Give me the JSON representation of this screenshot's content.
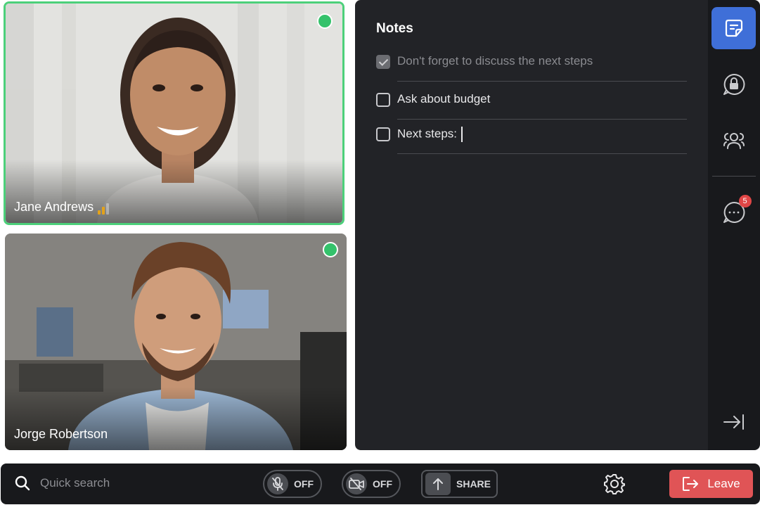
{
  "participants": [
    {
      "name": "Jane Andrews",
      "status_color": "#34c26b",
      "signal_level": 2,
      "active_speaker": true
    },
    {
      "name": "Jorge Robertson",
      "status_color": "#34c26b",
      "active_speaker": false
    }
  ],
  "notes": {
    "title": "Notes",
    "items": [
      {
        "text": "Don't forget to discuss the next steps",
        "checked": true
      },
      {
        "text": "Ask about budget",
        "checked": false
      },
      {
        "text": "Next steps:",
        "checked": false,
        "editing": true
      }
    ]
  },
  "side_rail": {
    "items": [
      {
        "icon": "notes-icon",
        "active": true
      },
      {
        "icon": "lock-chat-icon",
        "active": false
      },
      {
        "icon": "participants-icon",
        "active": false
      },
      {
        "icon": "chat-icon",
        "active": false,
        "badge": "5"
      }
    ],
    "collapse_icon": "collapse-panel-icon"
  },
  "toolbar": {
    "search_placeholder": "Quick search",
    "mic_label": "OFF",
    "camera_label": "OFF",
    "share_label": "SHARE",
    "leave_label": "Leave"
  },
  "colors": {
    "accent": "#3f6fd8",
    "leave": "#e05456",
    "online": "#34c26b",
    "speaker_border": "#4cd07a",
    "badge": "#e04646"
  }
}
